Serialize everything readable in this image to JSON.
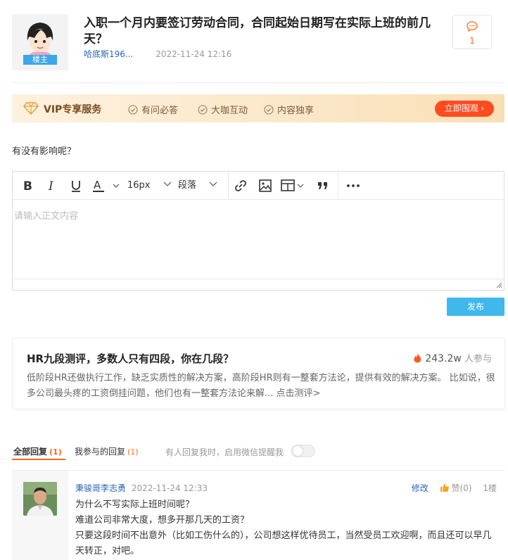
{
  "post": {
    "title": "入职一个月内要签订劳动合同，合同起始日期写在实际上班的前几天？",
    "author": "哈底斯196...",
    "time": "2022-11-24 12:16",
    "badge": "楼主",
    "comment_count": "1",
    "body": "有没有影响呢？"
  },
  "vip": {
    "title": "VIP专享服务",
    "features": [
      "有问必答",
      "大咖互动",
      "内容独享"
    ],
    "button": "立即围观 ›",
    "accent": "#ff4b1f"
  },
  "editor": {
    "font_size": "16px",
    "paragraph": "段落",
    "placeholder": "请输入正文内容",
    "toolbar_icons": [
      "bold-icon",
      "italic-icon",
      "underline-icon",
      "font-color-icon",
      "link-icon",
      "image-icon",
      "table-icon",
      "quote-icon",
      "more-icon"
    ]
  },
  "publish": {
    "label": "发布",
    "color": "#40b8ec"
  },
  "promo": {
    "title": "HR九段测评，多数人只有四段，你在几段？",
    "participants": "243.2w",
    "participants_suffix": "人参与",
    "description": "低阶段HR还做执行工作，缺乏实质性的解决方案，高阶段HR则有一整套方法论，提供有效的解决方案。 比如说，很多公司最头疼的工资倒挂问题，他们也有一整套方法论来解... 点击测评>"
  },
  "tabs": {
    "all_replies": "全部回复",
    "all_count": "(1)",
    "my_replies": "我参与的回复",
    "my_count": "(1)",
    "notify": "有人回复我时，启用微信提醒我"
  },
  "reply": {
    "author": "秉骏哥李志勇",
    "time": "2022-11-24 12:33",
    "edit": "修改",
    "like": "赞(0)",
    "floor": "1楼",
    "lines": [
      "为什么不写实际上班时间呢？",
      "难道公司非常大度，想多开那几天的工资？",
      "只要这段时间不出意外（比如工伤什么的），公司想这样优待员工，当然受员工欢迎啊，而且还可以早几天转正，对吧。"
    ]
  }
}
